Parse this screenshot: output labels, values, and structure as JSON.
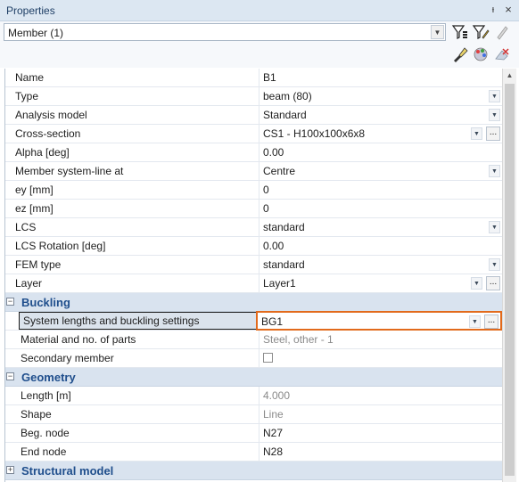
{
  "panel": {
    "title": "Properties",
    "pin_glyph": "ᵼ",
    "close_glyph": "×"
  },
  "selector": {
    "value": "Member (1)"
  },
  "rows": [
    {
      "name": "Name",
      "value": "B1"
    },
    {
      "name": "Type",
      "value": "beam (80)"
    },
    {
      "name": "Analysis model",
      "value": "Standard"
    },
    {
      "name": "Cross-section",
      "value": "CS1 - H100x100x6x8"
    },
    {
      "name": "Alpha [deg]",
      "value": "0.00"
    },
    {
      "name": "Member system-line at",
      "value": "Centre"
    },
    {
      "name": "ey [mm]",
      "value": "0"
    },
    {
      "name": "ez [mm]",
      "value": "0"
    },
    {
      "name": "LCS",
      "value": "standard"
    },
    {
      "name": "LCS Rotation [deg]",
      "value": "0.00"
    },
    {
      "name": "FEM type",
      "value": "standard"
    },
    {
      "name": "Layer",
      "value": "Layer1"
    }
  ],
  "groups": {
    "buckling": {
      "title": "Buckling",
      "rows": [
        {
          "name": "System lengths and buckling settings",
          "value": "BG1"
        },
        {
          "name": "Material and no. of parts",
          "value": "Steel, other - 1"
        },
        {
          "name": "Secondary member",
          "value": ""
        }
      ]
    },
    "geometry": {
      "title": "Geometry",
      "rows": [
        {
          "name": "Length [m]",
          "value": "4.000"
        },
        {
          "name": "Shape",
          "value": "Line"
        },
        {
          "name": "Beg. node",
          "value": "N27"
        },
        {
          "name": "End node",
          "value": "N28"
        }
      ]
    },
    "structural": {
      "title": "Structural model"
    }
  },
  "glyphs": {
    "dropdown": "▼",
    "ellipsis": "...",
    "collapse": "−",
    "expand": "+"
  },
  "colors": {
    "header": "#dce7f2",
    "group": "#d9e3ef",
    "group_text": "#1f4e8c",
    "highlight": "#e26a1c"
  },
  "icons": [
    "filter-icon",
    "filter-edit-icon",
    "pencil-icon",
    "brush-icon",
    "color-palette-icon",
    "clear-icon"
  ]
}
